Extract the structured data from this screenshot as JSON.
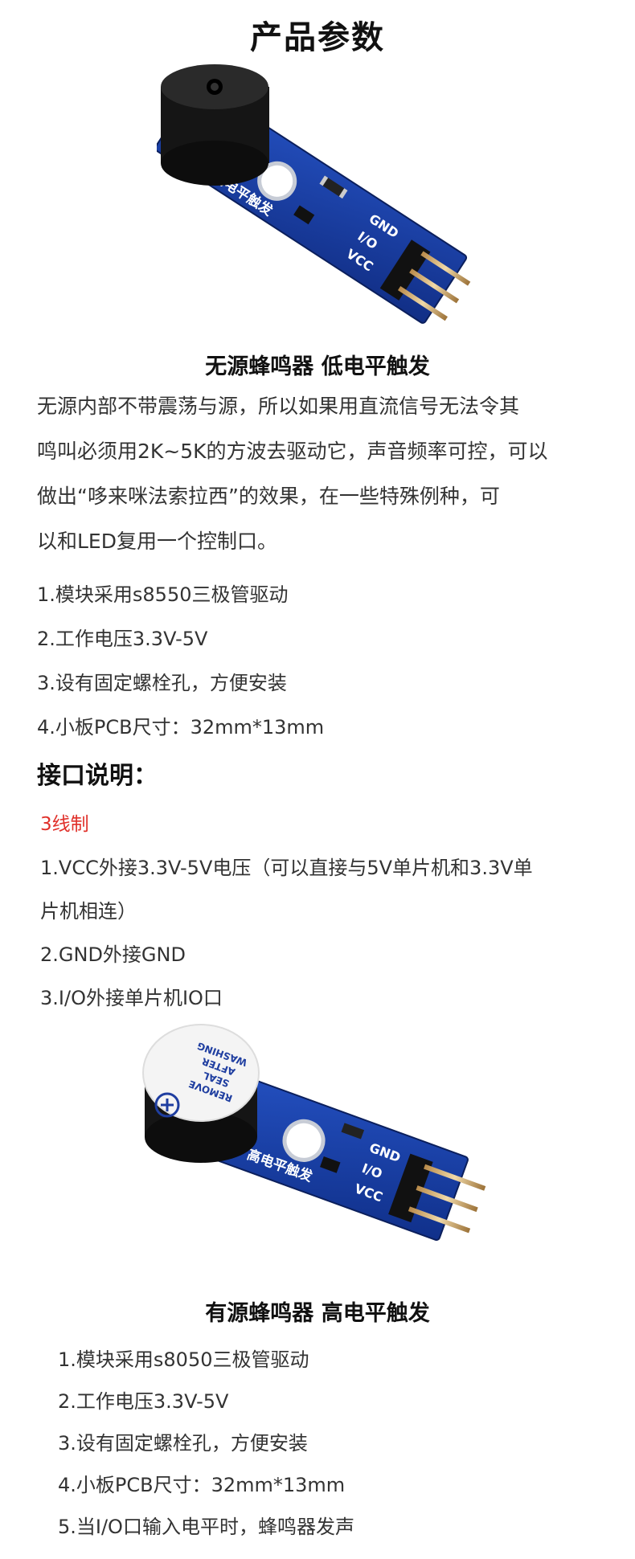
{
  "page_title": "产品参数",
  "section1": {
    "caption": "无源蜂鸣器 低电平触发",
    "board_label": "低电平触发",
    "pins": [
      "GND",
      "I/O",
      "VCC"
    ],
    "description_lines": [
      "无源内部不带震荡与源，所以如果用直流信号无法令其",
      "鸣叫必须用2K~5K的方波去驱动它，声音频率可控，可以",
      "做出“哆来咪法索拉西”的效果，在一些特殊例种，可",
      "以和LED复用一个控制口。"
    ],
    "specs": [
      "1.模块采用s8550三极管驱动",
      "2.工作电压3.3V-5V",
      "3.设有固定螺栓孔，方便安装",
      "4.小板PCB尺寸：32mm*13mm"
    ]
  },
  "interface": {
    "heading": "接口说明：",
    "wire_note": "3线制",
    "lines": [
      "1.VCC外接3.3V-5V电压（可以直接与5V单片机和3.3V单",
      "片机相连）",
      "2.GND外接GND",
      "3.I/O外接单片机IO口"
    ]
  },
  "section2": {
    "caption": "有源蜂鸣器 高电平触发",
    "board_label": "高电平触发",
    "sticker_lines": [
      "REMOVE",
      "SEAL",
      "AFTER",
      "WASHING"
    ],
    "specs": [
      "1.模块采用s8050三极管驱动",
      "2.工作电压3.3V-5V",
      "3.设有固定螺栓孔，方便安装",
      "4.小板PCB尺寸：32mm*13mm",
      "5.当I/O口输入电平时，蜂鸣器发声"
    ]
  },
  "colors": {
    "pcb": "#1a3fa6",
    "accent_red": "#e0302a"
  }
}
